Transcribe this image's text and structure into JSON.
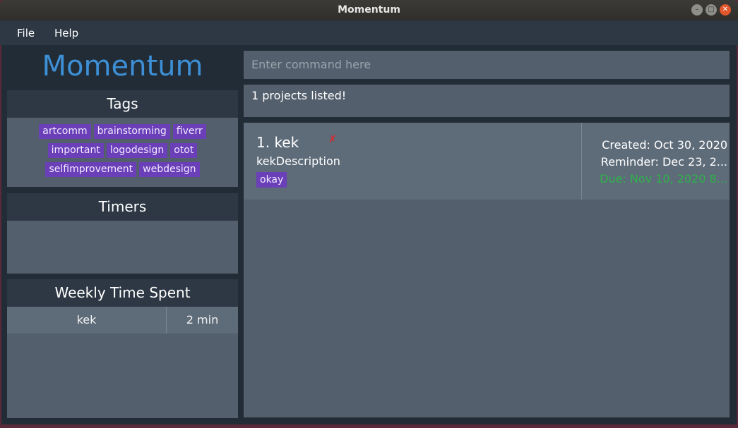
{
  "window": {
    "title": "Momentum"
  },
  "menubar": {
    "file_label": "File",
    "help_label": "Help"
  },
  "sidebar": {
    "brand": "Momentum",
    "tags_title": "Tags",
    "tags": [
      "artcomm",
      "brainstorming",
      "fiverr",
      "important",
      "logodesign",
      "otot",
      "selfimprovement",
      "webdesign"
    ],
    "timers_title": "Timers",
    "weekly_title": "Weekly Time Spent",
    "weekly_rows": [
      {
        "name": "kek",
        "time": "2 min"
      }
    ]
  },
  "command": {
    "placeholder": "Enter command here"
  },
  "result": {
    "text": "1 projects listed!"
  },
  "projects": [
    {
      "title": "1. kek",
      "description": "kekDescription",
      "tag": "okay",
      "created": "Created: Oct 30, 2020",
      "reminder": "Reminder: Dec 23, 2...",
      "due": "Due: Nov 10, 2020 8..."
    }
  ],
  "colors": {
    "brand": "#3d8fd6",
    "tag_bg": "#6a3fb8",
    "due": "#2eb34a",
    "delete_mark": "#e0262b"
  }
}
